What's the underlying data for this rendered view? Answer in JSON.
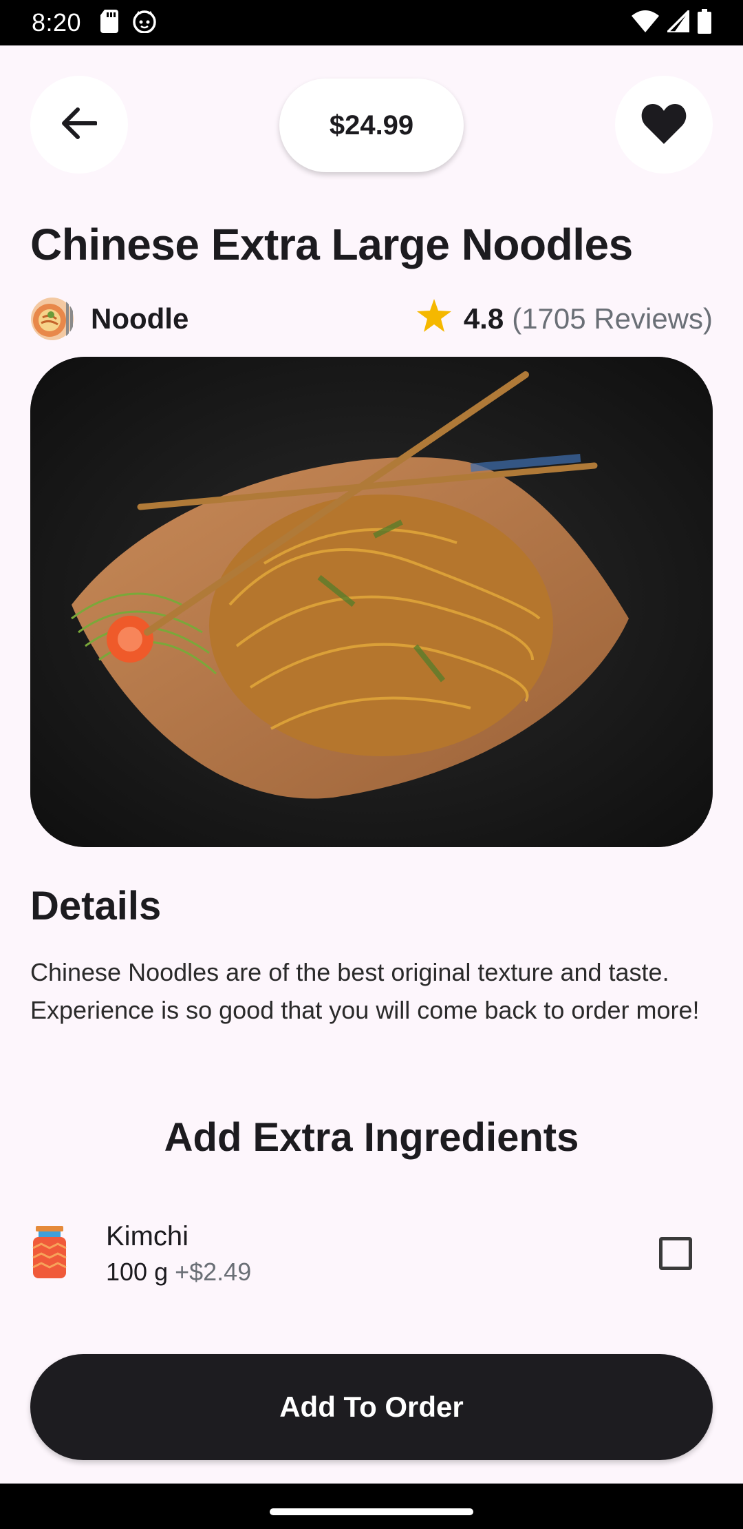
{
  "status_bar": {
    "time": "8:20",
    "icons": [
      "sd-card-icon",
      "cat-face-icon",
      "wifi-icon",
      "signal-icon",
      "battery-icon"
    ]
  },
  "header": {
    "back_icon": "arrow-left-icon",
    "price": "$24.99",
    "favorite_icon": "heart-icon"
  },
  "product": {
    "title": "Chinese Extra Large Noodles",
    "category": "Noodle",
    "rating": "4.8",
    "reviews": "(1705 Reviews)",
    "image_alt": "noodles-photo"
  },
  "details": {
    "heading": "Details",
    "text": "Chinese Noodles are of the best original texture and taste. Experience is so good that you will come back to order more!"
  },
  "extras": {
    "heading": "Add Extra Ingredients",
    "items": [
      {
        "name": "Kimchi",
        "qty": "100 g",
        "price": "+$2.49",
        "checked": false
      }
    ]
  },
  "cta": {
    "label": "Add To Order"
  },
  "colors": {
    "background": "#fdf6fc",
    "button_dark": "#1d1c20",
    "star": "#f5b800",
    "muted_text": "#6a6f76"
  }
}
